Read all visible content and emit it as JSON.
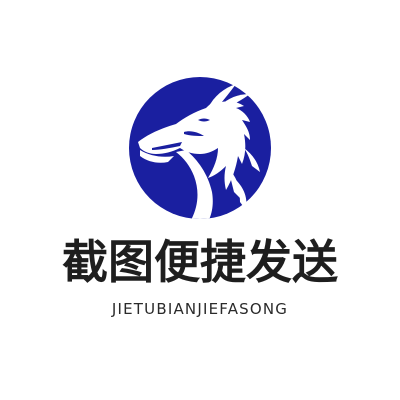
{
  "logo": {
    "title": "截图便捷发送",
    "subtitle": "JIETUBIANJIEFASONG",
    "emblem_icon": "dragon-head-icon",
    "colors": {
      "circle": "#1a1fa0",
      "dragon": "#ffffff",
      "text": "#1e1e1e",
      "background": "#ffffff"
    }
  }
}
